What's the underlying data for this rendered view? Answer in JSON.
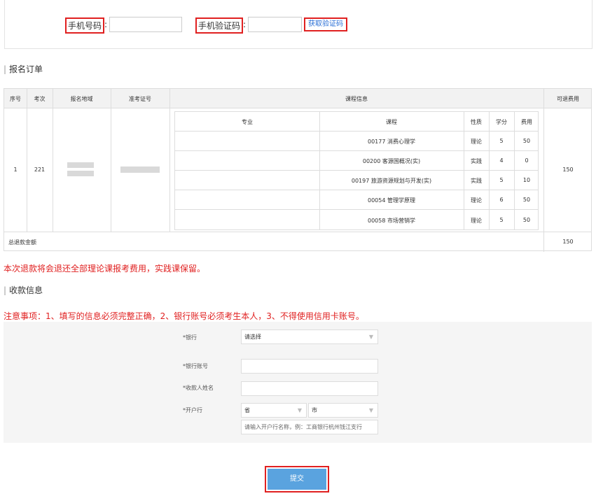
{
  "verify": {
    "phone_label": "手机号码",
    "code_label": "手机验证码",
    "colon": ":",
    "get_code_button": "获取验证码"
  },
  "order": {
    "section_title": "报名订单",
    "headers": {
      "index": "序号",
      "exam": "考次",
      "region": "报名地域",
      "ticket": "准考证号",
      "course_info": "课程信息",
      "refundable": "可退费用"
    },
    "row": {
      "index": "1",
      "exam": "221",
      "refundable": "150"
    },
    "inner_headers": {
      "major": "专业",
      "course": "课程",
      "nature": "性质",
      "credit": "学分",
      "fee": "费用"
    },
    "courses": [
      {
        "course": "00177 消费心理学",
        "nature": "理论",
        "credit": "5",
        "fee": "50"
      },
      {
        "course": "00200 客源国概况(实)",
        "nature": "实践",
        "credit": "4",
        "fee": "0"
      },
      {
        "course": "00197 旅游资源规划与开发(实)",
        "nature": "实践",
        "credit": "5",
        "fee": "10"
      },
      {
        "course": "00054 管理学原理",
        "nature": "理论",
        "credit": "6",
        "fee": "50"
      },
      {
        "course": "00058 市场营销学",
        "nature": "理论",
        "credit": "5",
        "fee": "50"
      }
    ],
    "total_label": "总退款金额",
    "total_value": "150"
  },
  "refund_note": "本次退款将会退还全部理论课报考费用，实践课保留。",
  "payment": {
    "section_title": "收款信息",
    "notice": "注意事项：1、填写的信息必须完整正确，2、银行账号必须考生本人，3、不得使用信用卡账号。",
    "bank_label": "*银行",
    "bank_select": "请选择",
    "account_label": "*银行账号",
    "name_label": "*收款人姓名",
    "branch_label": "*开户行",
    "province_select": "省",
    "city_select": "市",
    "branch_placeholder": "请输入开户行名称，例：工商银行杭州钱江支行"
  },
  "submit_label": "提交",
  "colors": {
    "highlight": "#e02020",
    "primary": "#5aa3df",
    "link": "#2a6fd6"
  }
}
